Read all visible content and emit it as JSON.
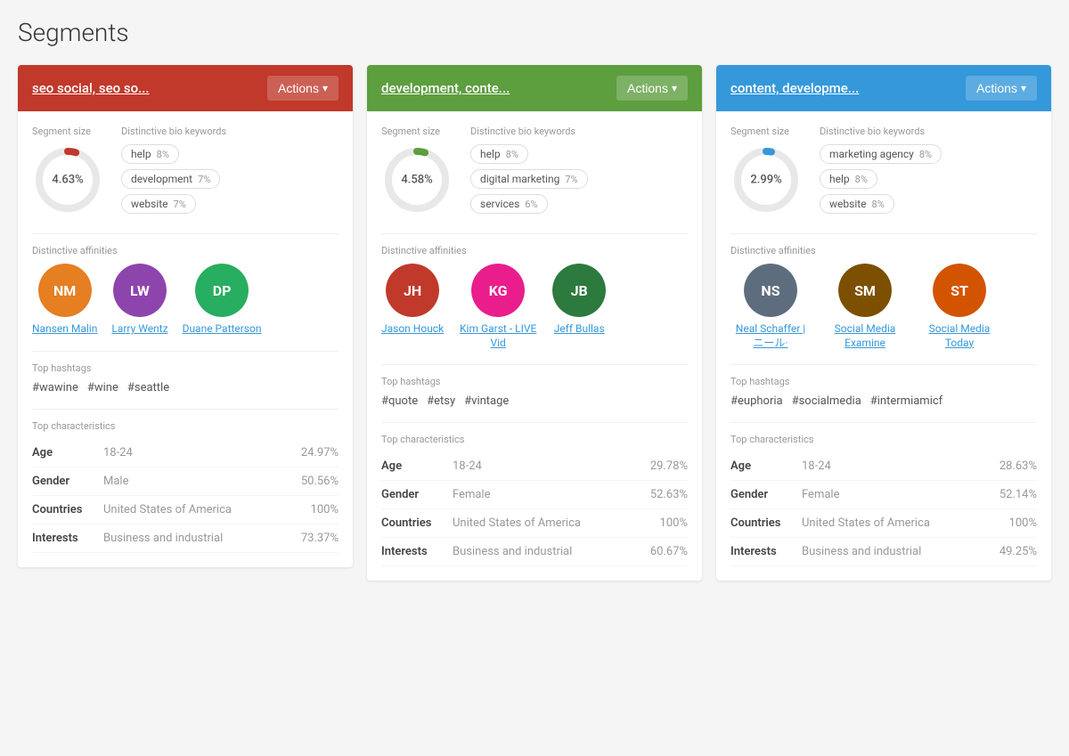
{
  "page": {
    "title": "Segments"
  },
  "segments": [
    {
      "id": "segment-1",
      "name": "seo social, seo so...",
      "header_color": "red",
      "actions_label": "Actions",
      "segment_size_label": "Segment size",
      "segment_size_value": "4.63%",
      "donut_pct": 4.63,
      "donut_color": "red",
      "bio_keywords_label": "Distinctive bio keywords",
      "keywords": [
        {
          "word": "help",
          "pct": "8%"
        },
        {
          "word": "development",
          "pct": "7%"
        },
        {
          "word": "website",
          "pct": "7%"
        }
      ],
      "affinities_label": "Distinctive affinities",
      "affinities": [
        {
          "name": "Nansen Malin",
          "initials": "NM",
          "color": "#e67e22"
        },
        {
          "name": "Larry Wentz",
          "initials": "LW",
          "color": "#8e44ad"
        },
        {
          "name": "Duane Patterson",
          "initials": "DP",
          "color": "#27ae60"
        }
      ],
      "hashtags_label": "Top hashtags",
      "hashtags": [
        "#wawine",
        "#wine",
        "#seattle"
      ],
      "characteristics_label": "Top characteristics",
      "characteristics": [
        {
          "label": "Age",
          "value": "18-24",
          "pct": "24.97%"
        },
        {
          "label": "Gender",
          "value": "Male",
          "pct": "50.56%"
        },
        {
          "label": "Countries",
          "value": "United States of America",
          "pct": "100%"
        },
        {
          "label": "Interests",
          "value": "Business and industrial",
          "pct": "73.37%"
        }
      ]
    },
    {
      "id": "segment-2",
      "name": "development, conte...",
      "header_color": "green",
      "actions_label": "Actions",
      "segment_size_label": "Segment size",
      "segment_size_value": "4.58%",
      "donut_pct": 4.58,
      "donut_color": "green",
      "bio_keywords_label": "Distinctive bio keywords",
      "keywords": [
        {
          "word": "help",
          "pct": "8%"
        },
        {
          "word": "digital marketing",
          "pct": "7%"
        },
        {
          "word": "services",
          "pct": "6%"
        }
      ],
      "affinities_label": "Distinctive affinities",
      "affinities": [
        {
          "name": "Jason Houck",
          "initials": "JH",
          "color": "#c0392b"
        },
        {
          "name": "Kim Garst - LIVE Vid",
          "initials": "KG",
          "color": "#e91e8c"
        },
        {
          "name": "Jeff Bullas",
          "initials": "JB",
          "color": "#2c7a3e"
        }
      ],
      "hashtags_label": "Top hashtags",
      "hashtags": [
        "#quote",
        "#etsy",
        "#vintage"
      ],
      "characteristics_label": "Top characteristics",
      "characteristics": [
        {
          "label": "Age",
          "value": "18-24",
          "pct": "29.78%"
        },
        {
          "label": "Gender",
          "value": "Female",
          "pct": "52.63%"
        },
        {
          "label": "Countries",
          "value": "United States of America",
          "pct": "100%"
        },
        {
          "label": "Interests",
          "value": "Business and industrial",
          "pct": "60.67%"
        }
      ]
    },
    {
      "id": "segment-3",
      "name": "content, developme...",
      "header_color": "blue",
      "actions_label": "Actions",
      "segment_size_label": "Segment size",
      "segment_size_value": "2.99%",
      "donut_pct": 2.99,
      "donut_color": "blue",
      "bio_keywords_label": "Distinctive bio keywords",
      "keywords": [
        {
          "word": "marketing agency",
          "pct": "8%"
        },
        {
          "word": "help",
          "pct": "8%"
        },
        {
          "word": "website",
          "pct": "8%"
        }
      ],
      "affinities_label": "Distinctive affinities",
      "affinities": [
        {
          "name": "Neal Schaffer | ニール·",
          "initials": "NS",
          "color": "#5d6d7e"
        },
        {
          "name": "Social Media Examine",
          "initials": "SM",
          "color": "#a04000"
        },
        {
          "name": "Social Media Today",
          "initials": "ST",
          "color": "#d35400"
        }
      ],
      "hashtags_label": "Top hashtags",
      "hashtags": [
        "#euphoria",
        "#socialmedia",
        "#intermiamicf"
      ],
      "characteristics_label": "Top characteristics",
      "characteristics": [
        {
          "label": "Age",
          "value": "18-24",
          "pct": "28.63%"
        },
        {
          "label": "Gender",
          "value": "Female",
          "pct": "52.14%"
        },
        {
          "label": "Countries",
          "value": "United States of America",
          "pct": "100%"
        },
        {
          "label": "Interests",
          "value": "Business and industrial",
          "pct": "49.25%"
        }
      ]
    }
  ]
}
